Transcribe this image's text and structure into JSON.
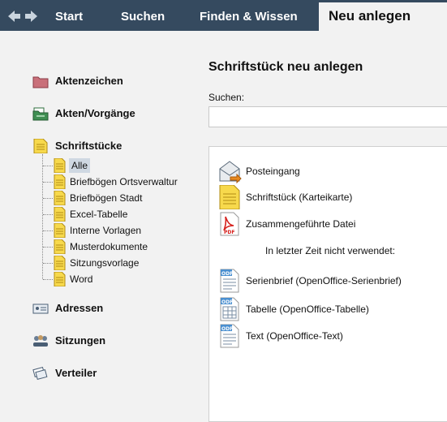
{
  "nav": {
    "back_forward_icon": "back-forward-arrows",
    "tabs": [
      {
        "label": "Start"
      },
      {
        "label": "Suchen"
      },
      {
        "label": "Finden & Wissen"
      },
      {
        "label": "Neu anlegen"
      }
    ]
  },
  "sidebar": {
    "items": [
      {
        "label": "Aktenzeichen",
        "icon": "folder-red-icon"
      },
      {
        "label": "Akten/Vorgänge",
        "icon": "folder-green-icon"
      },
      {
        "label": "Schriftstücke",
        "icon": "document-icon"
      },
      {
        "label": "Adressen",
        "icon": "address-card-icon"
      },
      {
        "label": "Sitzungen",
        "icon": "people-meeting-icon"
      },
      {
        "label": "Verteiler",
        "icon": "distribution-icon"
      }
    ],
    "subitems": [
      {
        "label": "Alle"
      },
      {
        "label": "Briefbögen Ortsverwaltur"
      },
      {
        "label": "Briefbögen Stadt"
      },
      {
        "label": "Excel-Tabelle"
      },
      {
        "label": "Interne Vorlagen"
      },
      {
        "label": "Musterdokumente"
      },
      {
        "label": "Sitzungsvorlage"
      },
      {
        "label": "Word"
      }
    ]
  },
  "main": {
    "title": "Schriftstück neu anlegen",
    "search_label": "Suchen:",
    "search_value": "",
    "options": [
      {
        "label": "Posteingang",
        "icon": "mail-inbox-icon"
      },
      {
        "label": "Schriftstück (Karteikarte)",
        "icon": "document-icon"
      },
      {
        "label": "Zusammengeführte Datei",
        "icon": "pdf-icon"
      }
    ],
    "unused_note": "In letzter Zeit nicht verwendet:",
    "unused_options": [
      {
        "label": "Serienbrief (OpenOffice-Serienbrief)",
        "icon": "odf-text-icon"
      },
      {
        "label": "Tabelle (OpenOffice-Tabelle)",
        "icon": "odf-spreadsheet-icon"
      },
      {
        "label": "Text (OpenOffice-Text)",
        "icon": "odf-text-icon"
      }
    ]
  },
  "colors": {
    "topbar": "#354a5f",
    "background": "#f2f2f2",
    "selection": "#cfd8e2",
    "doc_yellow": "#f7d94c"
  }
}
